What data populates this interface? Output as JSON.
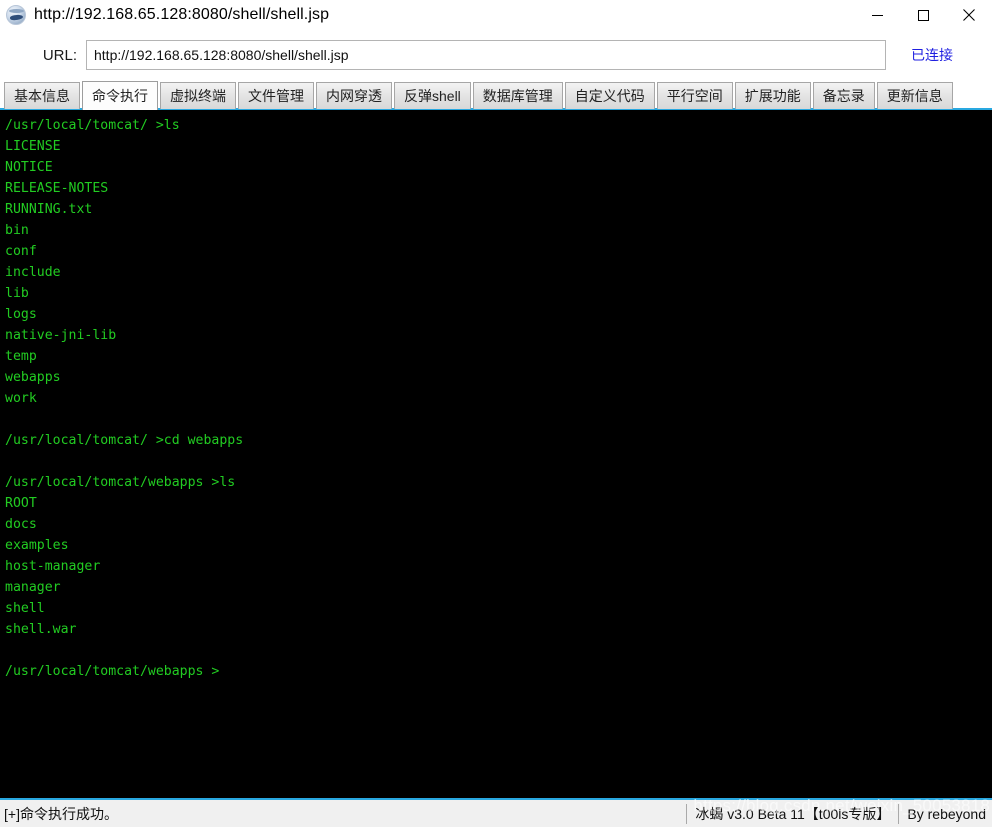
{
  "window": {
    "title": "http://192.168.65.128:8080/shell/shell.jsp",
    "icon": "app-scorpion-icon",
    "minimize_label": "—",
    "maximize_label": "□",
    "close_label": "✕"
  },
  "url_bar": {
    "label": "URL:",
    "value": "http://192.168.65.128:8080/shell/shell.jsp",
    "placeholder": "http://",
    "connect_status": "已连接"
  },
  "tabs": [
    {
      "label": "基本信息",
      "active": false
    },
    {
      "label": "命令执行",
      "active": true
    },
    {
      "label": "虚拟终端",
      "active": false
    },
    {
      "label": "文件管理",
      "active": false
    },
    {
      "label": "内网穿透",
      "active": false
    },
    {
      "label": "反弹shell",
      "active": false
    },
    {
      "label": "数据库管理",
      "active": false
    },
    {
      "label": "自定义代码",
      "active": false
    },
    {
      "label": "平行空间",
      "active": false
    },
    {
      "label": "扩展功能",
      "active": false
    },
    {
      "label": "备忘录",
      "active": false
    },
    {
      "label": "更新信息",
      "active": false
    }
  ],
  "terminal": {
    "foreground_color": "#22cc22",
    "background_color": "#000000",
    "lines": [
      "/usr/local/tomcat/ >ls",
      "LICENSE",
      "NOTICE",
      "RELEASE-NOTES",
      "RUNNING.txt",
      "bin",
      "conf",
      "include",
      "lib",
      "logs",
      "native-jni-lib",
      "temp",
      "webapps",
      "work",
      "",
      "/usr/local/tomcat/ >cd webapps",
      "",
      "/usr/local/tomcat/webapps >ls",
      "ROOT",
      "docs",
      "examples",
      "host-manager",
      "manager",
      "shell",
      "shell.war",
      "",
      "/usr/local/tomcat/webapps >"
    ]
  },
  "status_bar": {
    "message": "[+]命令执行成功。",
    "version": "冰蝎 v3.0 Beta 11【t00ls专版】",
    "author": "By rebeyond",
    "watermark": "https://blog.csdn.net/weixin_50053818"
  }
}
